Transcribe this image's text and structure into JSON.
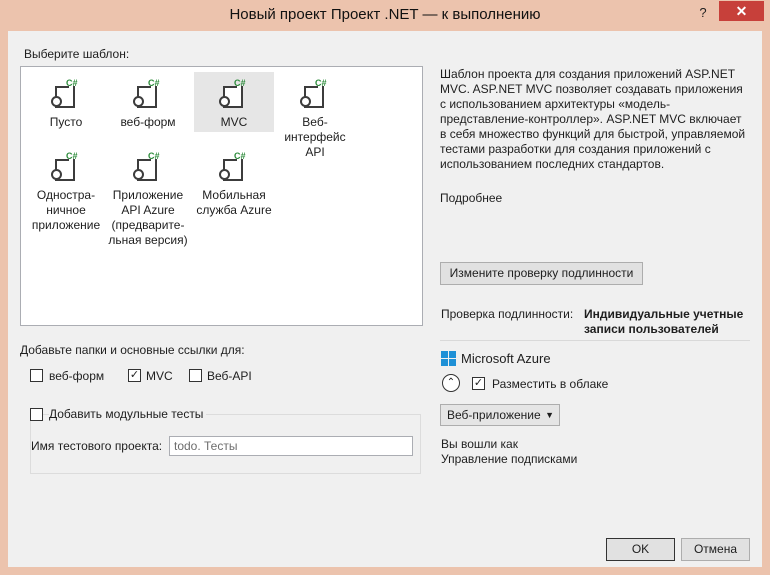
{
  "window": {
    "title": "Новый проект Проект .NET — к выполнению",
    "help_label": "?",
    "close_label": "✕"
  },
  "templates": {
    "label": "Выберите шаблон:",
    "items": [
      {
        "name": "Пусто",
        "selected": false
      },
      {
        "name": "веб-форм",
        "selected": false
      },
      {
        "name": "MVC",
        "selected": true
      },
      {
        "name": "Веб-интерфейс\nAPI",
        "selected": false
      },
      {
        "name": "Одностра-\nничное\nприложение",
        "selected": false
      },
      {
        "name": "Приложение\nAPI Azure\n(предварите-\nльная версия)",
        "selected": false
      },
      {
        "name": "Мобильная\nслужба Azure",
        "selected": false
      }
    ],
    "icon_badge": "C#"
  },
  "description": {
    "text": "Шаблон проекта для создания приложений ASP.NET MVC. ASP.NET MVC позволяет создавать приложения с использованием архитектуры «модель-представление-контроллер». ASP.NET MVC включает в себя множество функций для быстрой, управляемой тестами разработки для создания приложений с использованием последних стандартов.",
    "more_link": "Подробнее"
  },
  "auth": {
    "change_button": "Измените проверку подлинности",
    "label": "Проверка подлинности:",
    "value": "Индивидуальные учетные записи пользователей"
  },
  "folders": {
    "label": "Добавьте папки и основные ссылки для:",
    "options": [
      {
        "label": "веб-форм",
        "checked": false
      },
      {
        "label": "MVC",
        "checked": true
      },
      {
        "label": "Веб-API",
        "checked": false
      }
    ]
  },
  "tests": {
    "add_label": "Добавить модульные тесты",
    "add_checked": false,
    "name_label": "Имя тестового проекта:",
    "name_value": "todo. Тесты"
  },
  "azure": {
    "title": "Microsoft Azure",
    "host_label": "Разместить в облаке",
    "host_checked": true,
    "collapse_glyph": "⌃",
    "type_value": "Веб-приложение",
    "signed_in": "Вы вошли как",
    "manage": "Управление подписками"
  },
  "buttons": {
    "ok": "OK",
    "cancel": "Отмена"
  },
  "colors": {
    "frame": "#ecc3ad",
    "close": "#c7403a",
    "azure": "#1e90d6"
  }
}
